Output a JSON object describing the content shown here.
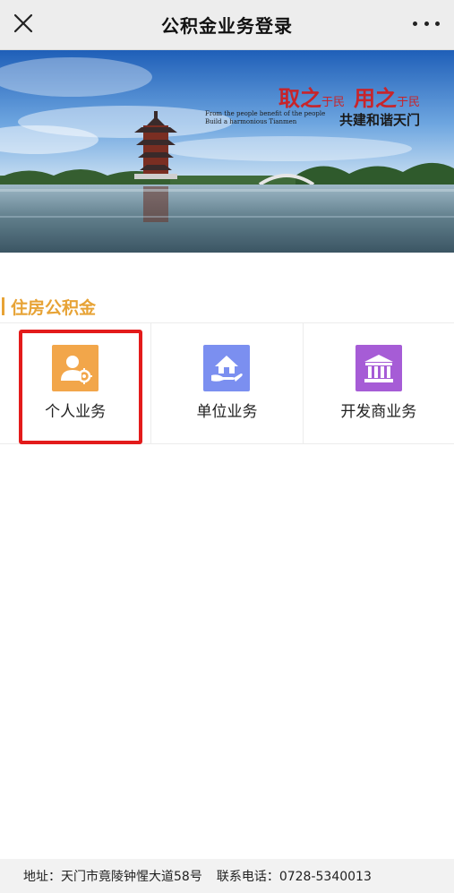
{
  "navbar": {
    "title": "公积金业务登录",
    "close_icon": "close-icon",
    "more_icon": "more-dots-icon"
  },
  "banner": {
    "slogan_big_1": "取之",
    "slogan_small_1": "于民",
    "slogan_big_2": "用之",
    "slogan_small_2": "于民",
    "slogan_en_1": "From the people benefit of the people",
    "slogan_en_2": "Build a harmonious Tianmen",
    "slogan_cn": "共建和谐天门"
  },
  "section": {
    "title": "住房公积金"
  },
  "services": [
    {
      "label": "个人业务",
      "icon": "personal-user-gear-icon",
      "color": "#f2a64a"
    },
    {
      "label": "单位业务",
      "icon": "hand-house-icon",
      "color": "#7b8ff0"
    },
    {
      "label": "开发商业务",
      "icon": "bank-building-icon",
      "color": "#a65cd6"
    }
  ],
  "footer": {
    "address_label": "地址：天门市竟陵钟惺大道58号",
    "phone_label": "联系电话：0728-5340013"
  },
  "colors": {
    "accent": "#e7a336",
    "highlight": "#e31b1b"
  }
}
